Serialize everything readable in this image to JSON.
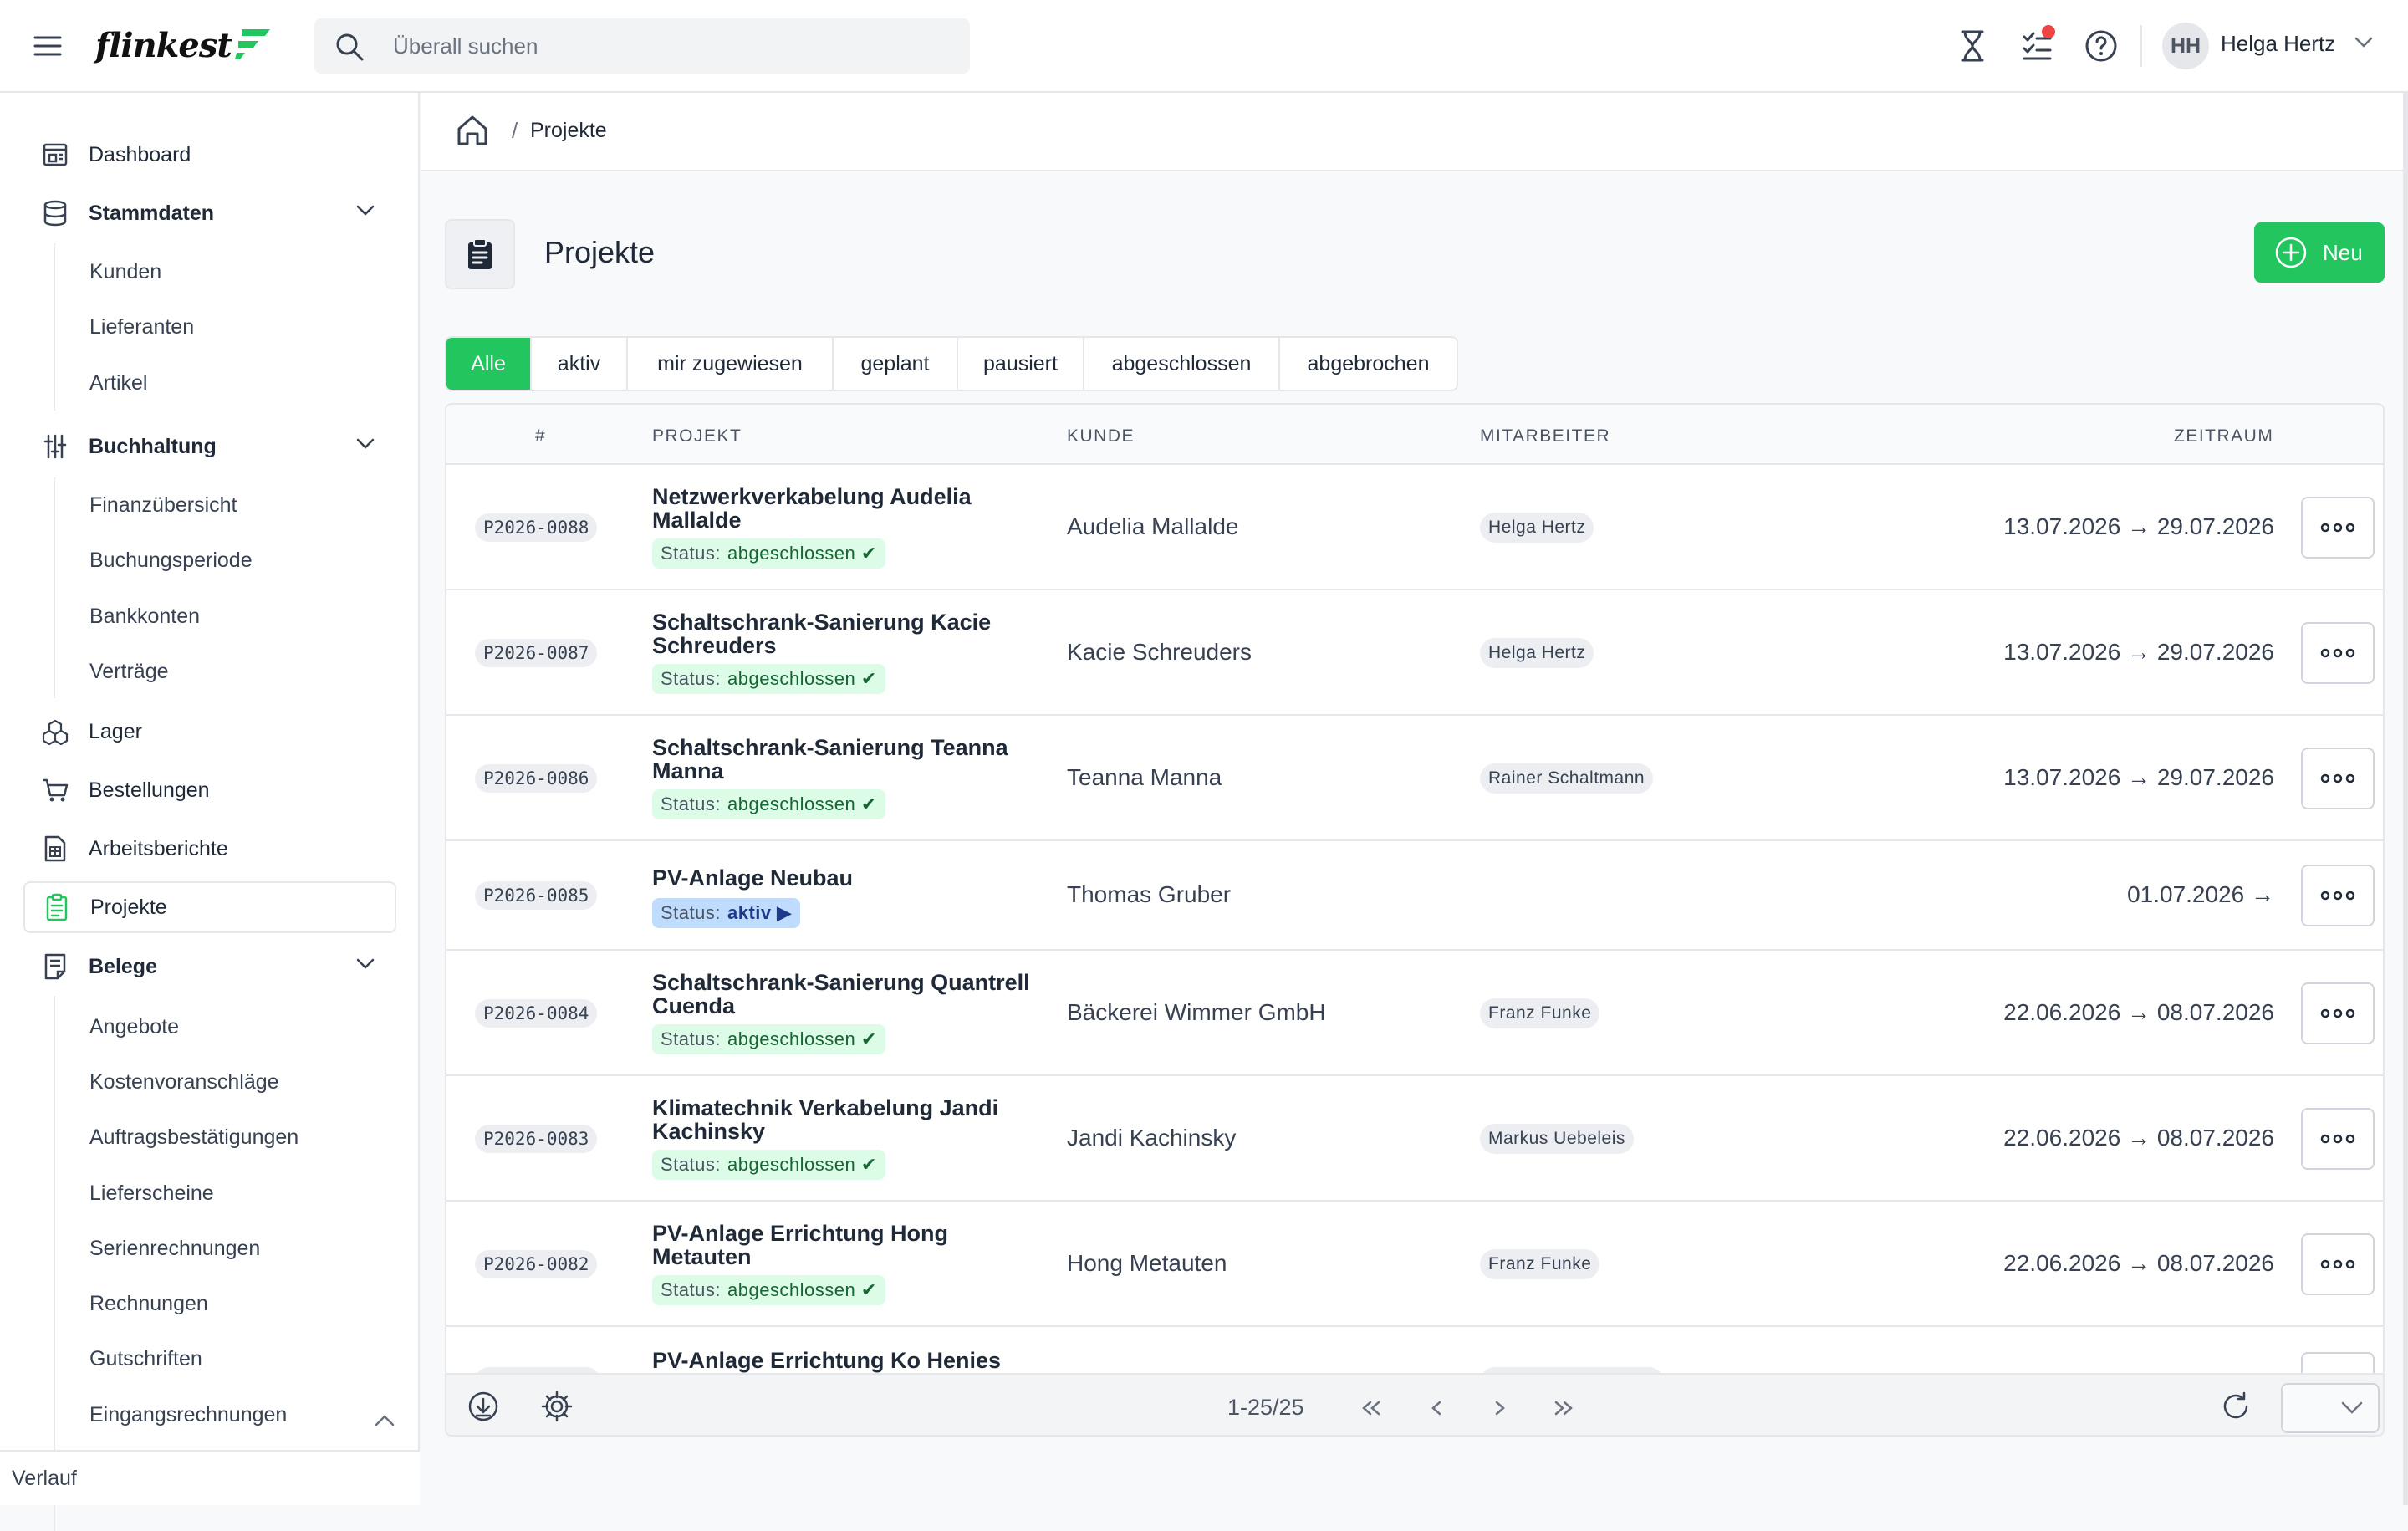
{
  "app": {
    "logo_text": "flinkest"
  },
  "search": {
    "placeholder": "Überall suchen"
  },
  "user": {
    "initials": "HH",
    "name": "Helga Hertz"
  },
  "sidebar": {
    "dashboard": "Dashboard",
    "stammdaten": "Stammdaten",
    "stammdaten_items": [
      "Kunden",
      "Lieferanten",
      "Artikel"
    ],
    "buchhaltung": "Buchhaltung",
    "buchhaltung_items": [
      "Finanzübersicht",
      "Buchungsperiode",
      "Bankkonten",
      "Verträge"
    ],
    "lager": "Lager",
    "bestellungen": "Bestellungen",
    "arbeitsberichte": "Arbeitsberichte",
    "projekte": "Projekte",
    "belege": "Belege",
    "belege_items": [
      "Angebote",
      "Kostenvoranschläge",
      "Auftragsbestätigungen",
      "Lieferscheine",
      "Serienrechnungen",
      "Rechnungen",
      "Gutschriften",
      "Eingangsrechnungen"
    ],
    "footer": "Verlauf"
  },
  "breadcrumb": {
    "current": "Projekte",
    "separator": "/"
  },
  "page": {
    "title": "Projekte",
    "new_button": "Neu"
  },
  "tabs": [
    "Alle",
    "aktiv",
    "mir zugewiesen",
    "geplant",
    "pausiert",
    "abgeschlossen",
    "abgebrochen"
  ],
  "table": {
    "headers": {
      "num": "#",
      "projekt": "PROJEKT",
      "kunde": "KUNDE",
      "mitarbeiter": "MITARBEITER",
      "zeitraum": "ZEITRAUM"
    },
    "status_key": "Status:",
    "rows": [
      {
        "id": "P2026-0088",
        "title": "Netzwerkverkabelung Audelia Mallalde",
        "status": "abgeschlossen ✔",
        "kunde": "Audelia Mallalde",
        "mitarbeiter": "Helga Hertz",
        "zeitraum": "13.07.2026 → 29.07.2026"
      },
      {
        "id": "P2026-0087",
        "title": "Schaltschrank-Sanierung Kacie Schreuders",
        "status": "abgeschlossen ✔",
        "kunde": "Kacie Schreuders",
        "mitarbeiter": "Helga Hertz",
        "zeitraum": "13.07.2026 → 29.07.2026"
      },
      {
        "id": "P2026-0086",
        "title": "Schaltschrank-Sanierung Teanna Manna",
        "status": "abgeschlossen ✔",
        "kunde": "Teanna Manna",
        "mitarbeiter": "Rainer Schaltmann",
        "zeitraum": "13.07.2026 → 29.07.2026"
      },
      {
        "id": "P2026-0085",
        "title": "PV-Anlage Neubau",
        "status": "aktiv ▶",
        "kunde": "Thomas Gruber",
        "mitarbeiter": "",
        "zeitraum": "01.07.2026 →"
      },
      {
        "id": "P2026-0084",
        "title": "Schaltschrank-Sanierung Quantrell Cuenda",
        "status": "abgeschlossen ✔",
        "kunde": "Bäckerei Wimmer GmbH",
        "mitarbeiter": "Franz Funke",
        "zeitraum": "22.06.2026 → 08.07.2026"
      },
      {
        "id": "P2026-0083",
        "title": "Klimatechnik Verkabelung Jandi Kachinsky",
        "status": "abgeschlossen ✔",
        "kunde": "Jandi Kachinsky",
        "mitarbeiter": "Markus Uebeleis",
        "zeitraum": "22.06.2026 → 08.07.2026"
      },
      {
        "id": "P2026-0082",
        "title": "PV-Anlage Errichtung Hong Metauten",
        "status": "abgeschlossen ✔",
        "kunde": "Hong Metauten",
        "mitarbeiter": "Franz Funke",
        "zeitraum": "22.06.2026 → 08.07.2026"
      },
      {
        "id": "",
        "title": "PV-Anlage Errichtung Ko Henies",
        "status": "",
        "kunde": "",
        "mitarbeiter": "",
        "zeitraum": ""
      }
    ]
  },
  "pagination": {
    "range": "1-25/25"
  },
  "colors": {
    "accent": "#22c55e",
    "status_done_bg": "#dcfce7",
    "status_active_bg": "#bfdbfe",
    "notification": "#ef4444"
  }
}
